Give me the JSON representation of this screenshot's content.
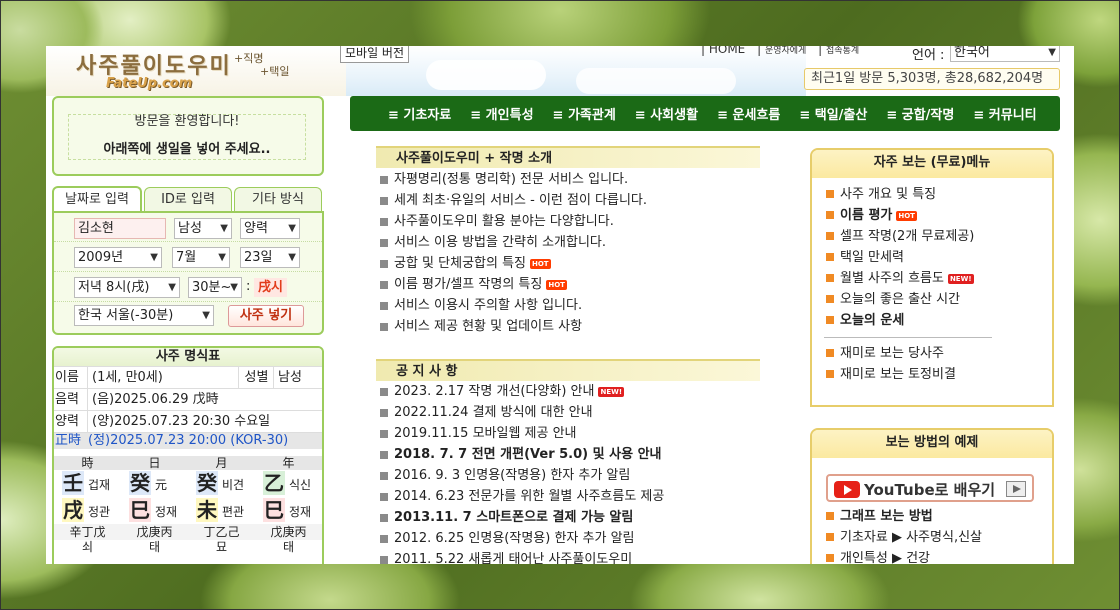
{
  "header": {
    "logo_title": "사주풀이도우미",
    "logo_sub1": "+직명",
    "logo_sub2": "+택일",
    "logo_url": "FateUp.com",
    "mobile_label": "모바일 버전",
    "links": [
      "HOME",
      "운영자에게",
      "접속통계"
    ],
    "lang_label": "언어 :",
    "lang_value": "한국어",
    "visits": "최근1일 방문 5,303명, 총28,682,204명"
  },
  "welcome": {
    "line1": "방문을 환영합니다!",
    "line2": "아래쪽에 생일을 넣어 주세요.."
  },
  "tabs": [
    "날짜로 입력",
    "ID로 입력",
    "기타 방식"
  ],
  "form": {
    "name": "김소현",
    "gender": "남성",
    "calendar": "양력",
    "year": "2009년",
    "month": "7월",
    "day": "23일",
    "hour": "저녁 8시(戌)",
    "minute": "30분~",
    "colon": ":",
    "sijin": "戌시",
    "region": "한국 서울(-30분)",
    "submit": "사주 넣기"
  },
  "myeong": {
    "title": "사주 명식표",
    "name_key": "이름",
    "name_val": "(1세, 만0세)",
    "gender_key": "성별",
    "gender_val": "남성",
    "lunar_key": "음력",
    "lunar_val": "(음)2025.06.29 戊時",
    "solar_key": "양력",
    "solar_val": "(양)2025.07.23 20:30 수요일",
    "jeongsi_key": "正時",
    "jeongsi_val": "(정)2025.07.23 20:00 (KOR-30)",
    "pillar_heads": [
      "時",
      "日",
      "月",
      "年"
    ],
    "stems": [
      {
        "char": "壬",
        "label": "겁재"
      },
      {
        "char": "癸",
        "label": "元"
      },
      {
        "char": "癸",
        "label": "비견"
      },
      {
        "char": "乙",
        "label": "식신"
      }
    ],
    "branches": [
      {
        "char": "戌",
        "label": "정관"
      },
      {
        "char": "巳",
        "label": "정재"
      },
      {
        "char": "未",
        "label": "편관"
      },
      {
        "char": "巳",
        "label": "정재"
      }
    ],
    "jijanggan": [
      "辛丁戊",
      "戊庚丙",
      "丁乙己",
      "戊庚丙"
    ],
    "unseong": [
      "쇠",
      "태",
      "묘",
      "태"
    ]
  },
  "nav": [
    "≡ 기초자료",
    "≡ 개인특성",
    "≡ 가족관계",
    "≡ 사회생활",
    "≡ 운세흐름",
    "≡ 택일/출산",
    "≡ 궁합/작명",
    "≡ 커뮤니티"
  ],
  "intro": {
    "title": "사주풀이도우미 + 작명 소개",
    "items": [
      "자평명리(정통 명리학) 전문 서비스 입니다.",
      "세계 최초·유일의 서비스 - 이런 점이 다릅니다.",
      "사주풀이도우미 활용 분야는 다양합니다.",
      "서비스 이용 방법을 간략히 소개합니다.",
      "궁합 및 단체궁합의 특징",
      "이름 평가/셀프 작명의 특징",
      "서비스 이용시 주의할 사항 입니다.",
      "서비스 제공 현황 및 업데이트 사항"
    ]
  },
  "notice": {
    "title": "공 지 사 항",
    "items": [
      "2023. 2.17 작명 개선(다양화) 안내",
      "2022.11.24 결제 방식에 대한 안내",
      "2019.11.15 모바일웹 제공 안내",
      "2018. 7. 7 전면 개편(Ver 5.0) 및 사용 안내",
      "2016. 9. 3 인명용(작명용) 한자 추가 알림",
      "2014. 6.23 전문가를 위한 월별 사주흐름도 제공",
      "2013.11. 7 스마트폰으로 결제 가능 알림",
      "2012. 6.25 인명용(작명용) 한자 추가 알림",
      "2011. 5.22 새롭게 태어난 사주풀이도우미"
    ]
  },
  "freq": {
    "title": "자주 보는 (무료)메뉴",
    "items": [
      "사주 개요 및 특징",
      "이름 평가",
      "셀프 작명(2개 무료제공)",
      "택일 만세력",
      "월별 사주의 흐름도",
      "오늘의 좋은 출산 시간",
      "오늘의 운세",
      "재미로 보는 당사주",
      "재미로 보는 토정비결"
    ]
  },
  "examples": {
    "title": "보는 방법의 예제",
    "youtube": "YouTube로 배우기",
    "items": [
      "그래프 보는 방법",
      "기초자료 ▶ 사주명식,신살",
      "개인특성 ▶ 건강"
    ]
  },
  "badges": {
    "hot": "HOT",
    "new": "NEW!"
  },
  "colors": {
    "nav_bg": "#1b6a16",
    "green_border": "#9ccc5c",
    "accent_red": "#e23b1b"
  }
}
